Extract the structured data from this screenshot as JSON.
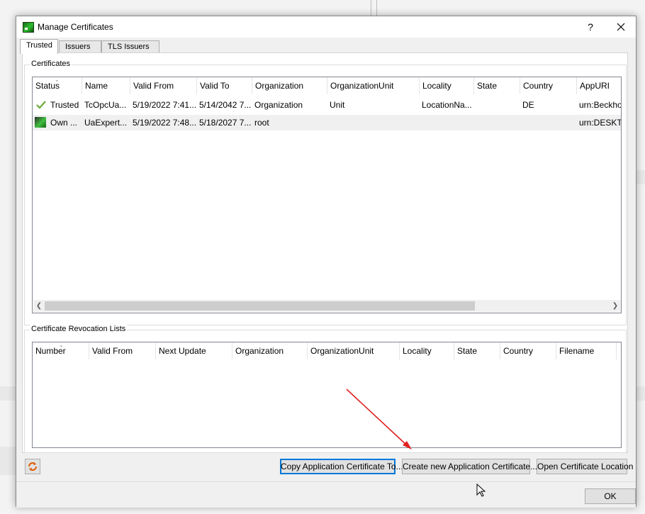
{
  "dialog": {
    "title": "Manage Certificates",
    "help_label": "?",
    "close_label": "✕"
  },
  "tabs": [
    {
      "label": "Trusted",
      "active": true
    },
    {
      "label": "Issuers",
      "active": false
    },
    {
      "label": "TLS Issuers",
      "active": false
    }
  ],
  "certificates": {
    "group_title": "Certificates",
    "columns": [
      "Status",
      "Name",
      "Valid From",
      "Valid To",
      "Organization",
      "OrganizationUnit",
      "Locality",
      "State",
      "Country",
      "AppURI"
    ],
    "rows": [
      {
        "status": "Trusted",
        "name": "TcOpcUa...",
        "valid_from": "5/19/2022 7:41...",
        "valid_to": "5/14/2042 7...",
        "organization": "Organization",
        "organization_unit": "Unit",
        "locality": "LocationNa...",
        "state": "",
        "country": "DE",
        "app_uri": "urn:Beckho",
        "icon": "check-icon"
      },
      {
        "status": "Own ...",
        "name": "UaExpert...",
        "valid_from": "5/19/2022 7:48...",
        "valid_to": "5/18/2027 7...",
        "organization": "root",
        "organization_unit": "",
        "locality": "",
        "state": "",
        "country": "",
        "app_uri": "urn:DESKT..",
        "icon": "own-certificate-icon"
      }
    ]
  },
  "crl": {
    "group_title": "Certificate Revocation Lists",
    "columns": [
      "Number",
      "Valid From",
      "Next Update",
      "Organization",
      "OrganizationUnit",
      "Locality",
      "State",
      "Country",
      "Filename"
    ]
  },
  "buttons": {
    "copy": "Copy Application Certificate To...",
    "create": "Create new Application Certificate...",
    "open": "Open Certificate Location",
    "ok": "OK"
  },
  "icons": {
    "refresh": "refresh-icon",
    "annotation": "red-arrow-annotation",
    "cursor": "mouse-cursor"
  },
  "colors": {
    "annotation_arrow": "#e02020",
    "check": "#6aaa3a",
    "default_button_border": "#0078d7"
  }
}
